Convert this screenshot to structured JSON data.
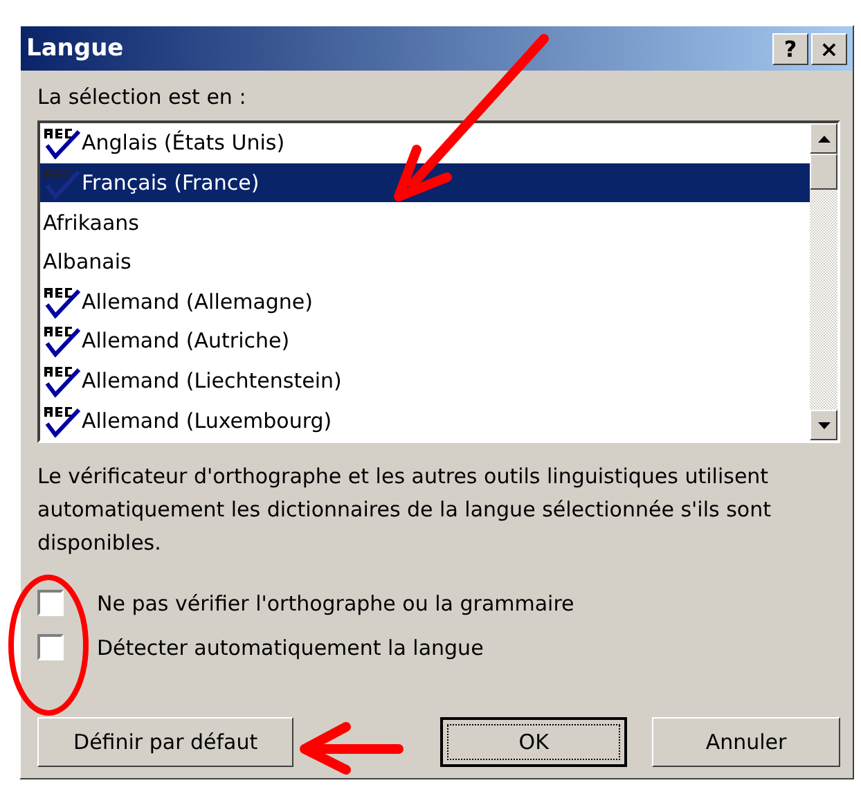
{
  "window": {
    "title": "Langue",
    "buttons": [
      "?",
      "×"
    ]
  },
  "selection_label": "La sélection est en :",
  "languages": [
    {
      "label": "Anglais (États Unis)",
      "kind": "proofing",
      "selected": false
    },
    {
      "label": "Français (France)",
      "kind": "proofing",
      "selected": true
    },
    {
      "label": "Afrikaans",
      "kind": "plain",
      "selected": false
    },
    {
      "label": "Albanais",
      "kind": "plain",
      "selected": false
    },
    {
      "label": "Allemand (Allemagne)",
      "kind": "proofing",
      "selected": false
    },
    {
      "label": "Allemand (Autriche)",
      "kind": "proofing",
      "selected": false
    },
    {
      "label": "Allemand (Liechtenstein)",
      "kind": "proofing",
      "selected": false
    },
    {
      "label": "Allemand (Luxembourg)",
      "kind": "proofing",
      "selected": false
    }
  ],
  "description": "Le vérificateur d'orthographe et les autres outils linguistiques utilisent automatiquement les dictionnaires de la langue sélectionnée s'ils sont disponibles.",
  "options": [
    {
      "label": "Ne pas vérifier l'orthographe ou la grammaire",
      "checked": false
    },
    {
      "label": "Détecter automatiquement la langue",
      "checked": false
    }
  ],
  "buttons": [
    {
      "label": "Définir par défaut",
      "default": false
    },
    {
      "label": "OK",
      "default": true
    },
    {
      "label": "Annuler",
      "default": false
    }
  ]
}
